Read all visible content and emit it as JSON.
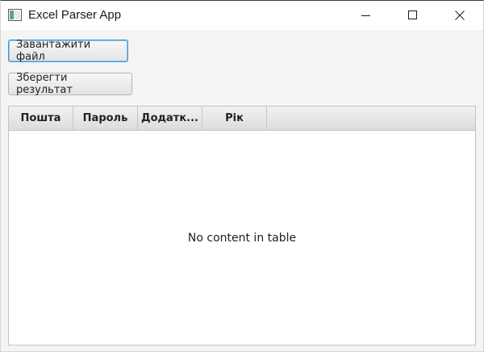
{
  "window": {
    "title": "Excel Parser App",
    "icon": "java-app-icon",
    "controls": [
      "minimize-icon",
      "maximize-icon",
      "close-icon"
    ]
  },
  "toolbar": {
    "load_label": "Завантажити файл",
    "save_label": "Зберегти результат"
  },
  "table": {
    "columns": [
      "Пошта",
      "Пароль",
      "Додатк...",
      "Рік"
    ],
    "empty_text": "No content in table"
  },
  "colors": {
    "focus_border": "#3a95d6",
    "titlebar_bg": "#ffffff",
    "window_bg": "#f4f4f4"
  }
}
